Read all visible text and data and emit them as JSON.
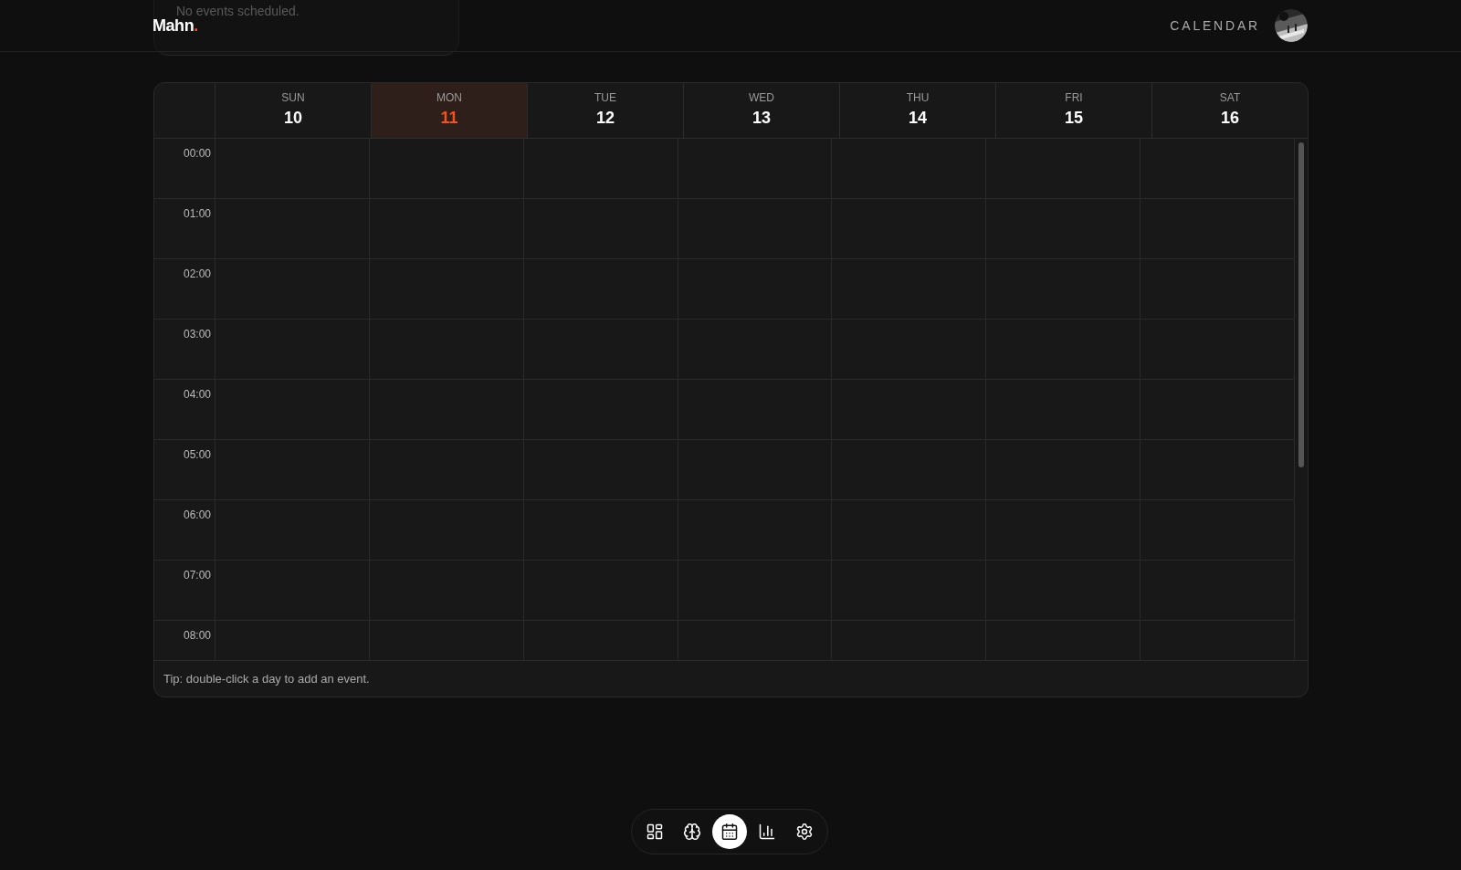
{
  "popover": {
    "message": "No events scheduled."
  },
  "header": {
    "logo": "Mahn",
    "logo_dot": ".",
    "section": "CALENDAR"
  },
  "calendar": {
    "days": [
      {
        "weekday": "SUN",
        "date": "10",
        "selected": false
      },
      {
        "weekday": "MON",
        "date": "11",
        "selected": true
      },
      {
        "weekday": "TUE",
        "date": "12",
        "selected": false
      },
      {
        "weekday": "WED",
        "date": "13",
        "selected": false
      },
      {
        "weekday": "THU",
        "date": "14",
        "selected": false
      },
      {
        "weekday": "FRI",
        "date": "15",
        "selected": false
      },
      {
        "weekday": "SAT",
        "date": "16",
        "selected": false
      }
    ],
    "hours": [
      "00:00",
      "01:00",
      "02:00",
      "03:00",
      "04:00",
      "05:00",
      "06:00",
      "07:00",
      "08:00"
    ],
    "tip": "Tip: double-click a day to add an event."
  },
  "dock": [
    {
      "kind": "dashboard",
      "selected": false
    },
    {
      "kind": "brain",
      "selected": false
    },
    {
      "kind": "calendar",
      "selected": true
    },
    {
      "kind": "chart",
      "selected": false
    },
    {
      "kind": "settings",
      "selected": false
    }
  ]
}
